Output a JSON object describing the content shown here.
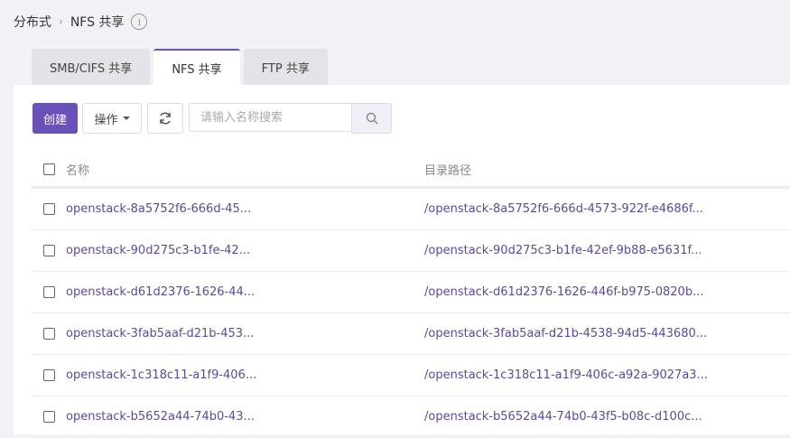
{
  "breadcrumb": {
    "parent": "分布式",
    "current": "NFS 共享"
  },
  "tabs": [
    {
      "label": "SMB/CIFS 共享"
    },
    {
      "label": "NFS 共享"
    },
    {
      "label": "FTP 共享"
    }
  ],
  "toolbar": {
    "create_label": "创建",
    "actions_label": "操作",
    "search_placeholder": "请输入名称搜索"
  },
  "table": {
    "columns": [
      "名称",
      "目录路径"
    ],
    "rows": [
      {
        "name": "openstack-8a5752f6-666d-45...",
        "path": "/openstack-8a5752f6-666d-4573-922f-e4686f..."
      },
      {
        "name": "openstack-90d275c3-b1fe-42...",
        "path": "/openstack-90d275c3-b1fe-42ef-9b88-e5631f..."
      },
      {
        "name": "openstack-d61d2376-1626-44...",
        "path": "/openstack-d61d2376-1626-446f-b975-0820b..."
      },
      {
        "name": "openstack-3fab5aaf-d21b-453...",
        "path": "/openstack-3fab5aaf-d21b-4538-94d5-443680..."
      },
      {
        "name": "openstack-1c318c11-a1f9-406...",
        "path": "/openstack-1c318c11-a1f9-406c-a92a-9027a3..."
      },
      {
        "name": "openstack-b5652a44-74b0-43...",
        "path": "/openstack-b5652a44-74b0-43f5-b08c-d100c..."
      }
    ]
  },
  "colors": {
    "accent": "#6a51b9",
    "link": "#5a4aa4",
    "background": "#f1f2f6"
  }
}
